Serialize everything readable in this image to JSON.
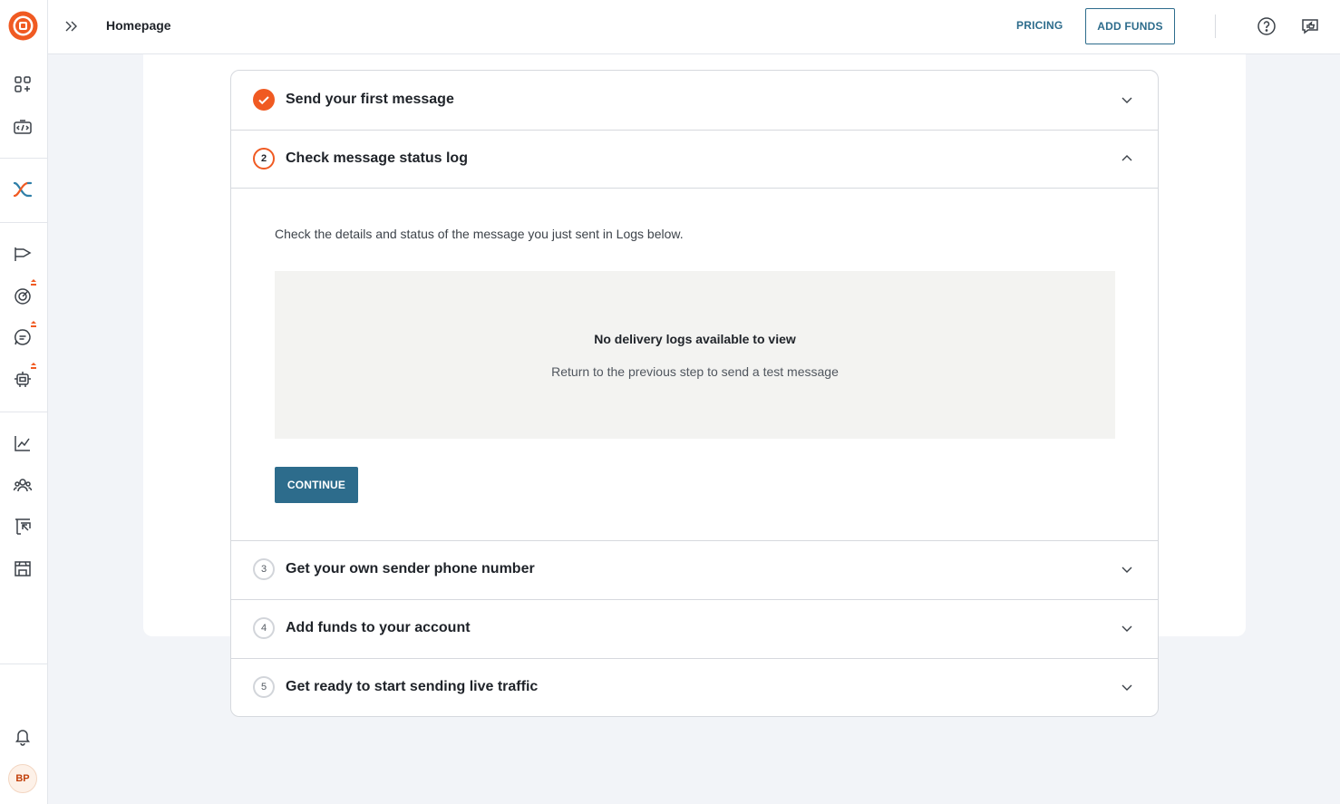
{
  "header": {
    "page_title": "Homepage",
    "pricing_label": "PRICING",
    "add_funds_label": "ADD FUNDS"
  },
  "sidebar": {
    "avatar_initials": "BP",
    "icons": [
      "app-logo-icon",
      "apps-add-icon",
      "developer-api-icon",
      "connector-icon",
      "campaigns-icon",
      "target-icon",
      "chat-icon",
      "bot-icon",
      "analytics-icon",
      "contacts-icon",
      "reports-icon",
      "store-icon",
      "notifications-icon"
    ]
  },
  "steps": [
    {
      "number": "1",
      "title": "Send your first message",
      "state": "completed"
    },
    {
      "number": "2",
      "title": "Check message status log",
      "state": "active",
      "description": "Check the details and status of the message you just sent in Logs below.",
      "empty_title": "No delivery logs available to view",
      "empty_subtitle": "Return to the previous step to send a test message",
      "continue_label": "CONTINUE"
    },
    {
      "number": "3",
      "title": "Get your own sender phone number",
      "state": "pending"
    },
    {
      "number": "4",
      "title": "Add funds to your account",
      "state": "pending"
    },
    {
      "number": "5",
      "title": "Get ready to start sending live traffic",
      "state": "pending"
    }
  ],
  "colors": {
    "accent_orange": "#f05a22",
    "primary_teal": "#2d6c8c",
    "background": "#f2f4f8"
  }
}
